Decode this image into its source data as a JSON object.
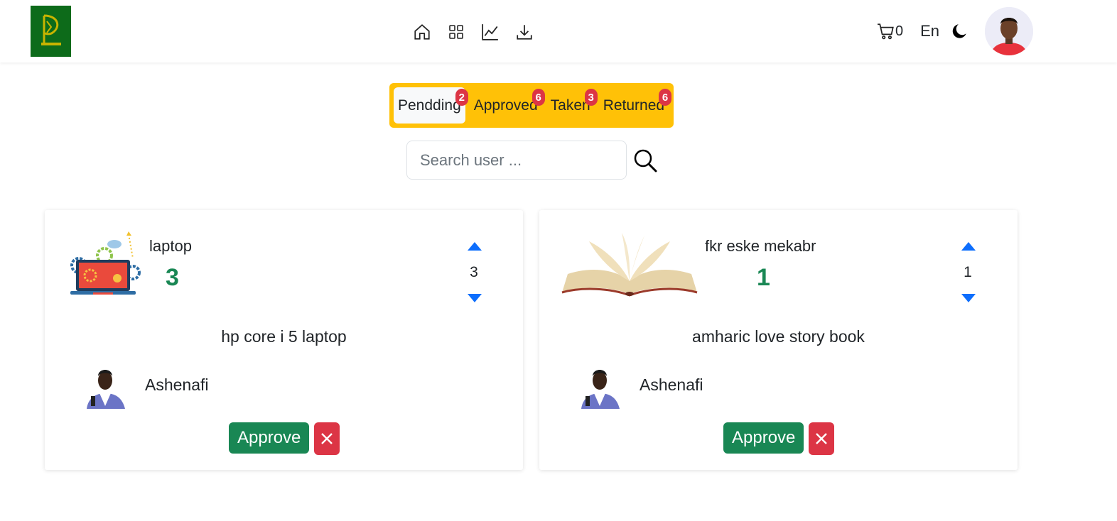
{
  "navbar": {
    "nav_icons": [
      "home-icon",
      "grid-icon",
      "chart-icon",
      "download-icon"
    ],
    "cart_count": "0",
    "language": "En"
  },
  "tabs": [
    {
      "label": "Pendding",
      "badge": "2",
      "active": true
    },
    {
      "label": "Approved",
      "badge": "6",
      "active": false
    },
    {
      "label": "Taken",
      "badge": "3",
      "active": false
    },
    {
      "label": "Returned",
      "badge": "6",
      "active": false
    }
  ],
  "search": {
    "placeholder": "Search user ..."
  },
  "requests": [
    {
      "item": "laptop",
      "count": "3",
      "quantity": "3",
      "description": "hp core i 5 laptop",
      "user": "Ashenafi",
      "approve_label": "Approve"
    },
    {
      "item": "fkr eske mekabr",
      "count": "1",
      "quantity": "1",
      "description": "amharic love story book",
      "user": "Ashenafi",
      "approve_label": "Approve"
    }
  ],
  "colors": {
    "accent": "#ffc107",
    "success": "#198754",
    "danger": "#dc3545",
    "primary": "#0d6efd"
  }
}
